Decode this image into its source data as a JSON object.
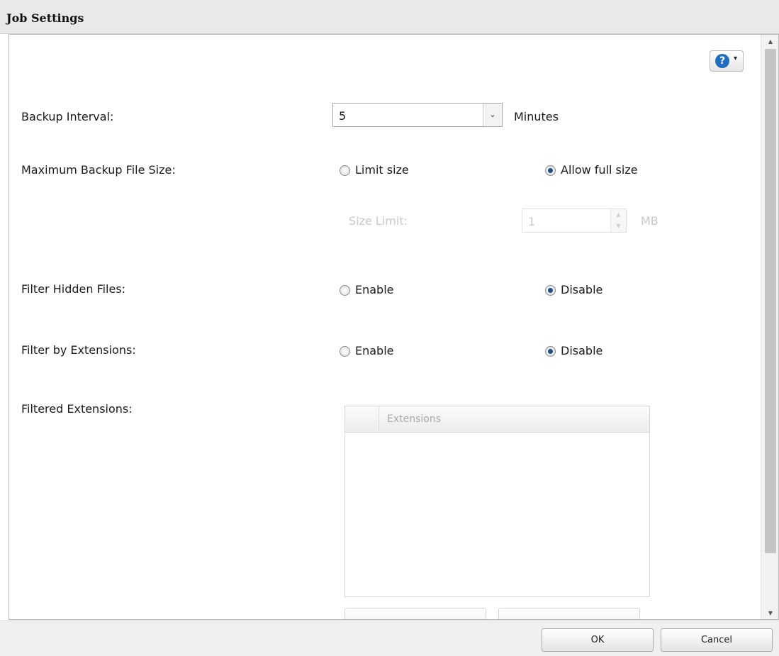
{
  "window": {
    "title": "Job Settings"
  },
  "help": {
    "icon": "help-icon",
    "symbol": "?",
    "caret": "▾"
  },
  "form": {
    "backup_interval": {
      "label": "Backup Interval:",
      "value": "5",
      "unit": "Minutes",
      "arrow": "⌄"
    },
    "max_file_size": {
      "label": "Maximum Backup File Size:",
      "option_limit": "Limit size",
      "option_full": "Allow full size",
      "selected": "Allow full size",
      "size_limit_label": "Size Limit:",
      "size_limit_value": "1",
      "size_limit_unit": "MB",
      "spin_up": "▲",
      "spin_down": "▼"
    },
    "filter_hidden": {
      "label": "Filter Hidden Files:",
      "option_enable": "Enable",
      "option_disable": "Disable",
      "selected": "Disable"
    },
    "filter_ext": {
      "label": "Filter by Extensions:",
      "option_enable": "Enable",
      "option_disable": "Disable",
      "selected": "Disable"
    },
    "filtered_ext": {
      "label": "Filtered Extensions:",
      "column_header": "Extensions"
    }
  },
  "scrollbar": {
    "up": "▲",
    "down": "▼"
  },
  "footer": {
    "ok_label": "OK",
    "cancel_label": "Cancel"
  }
}
